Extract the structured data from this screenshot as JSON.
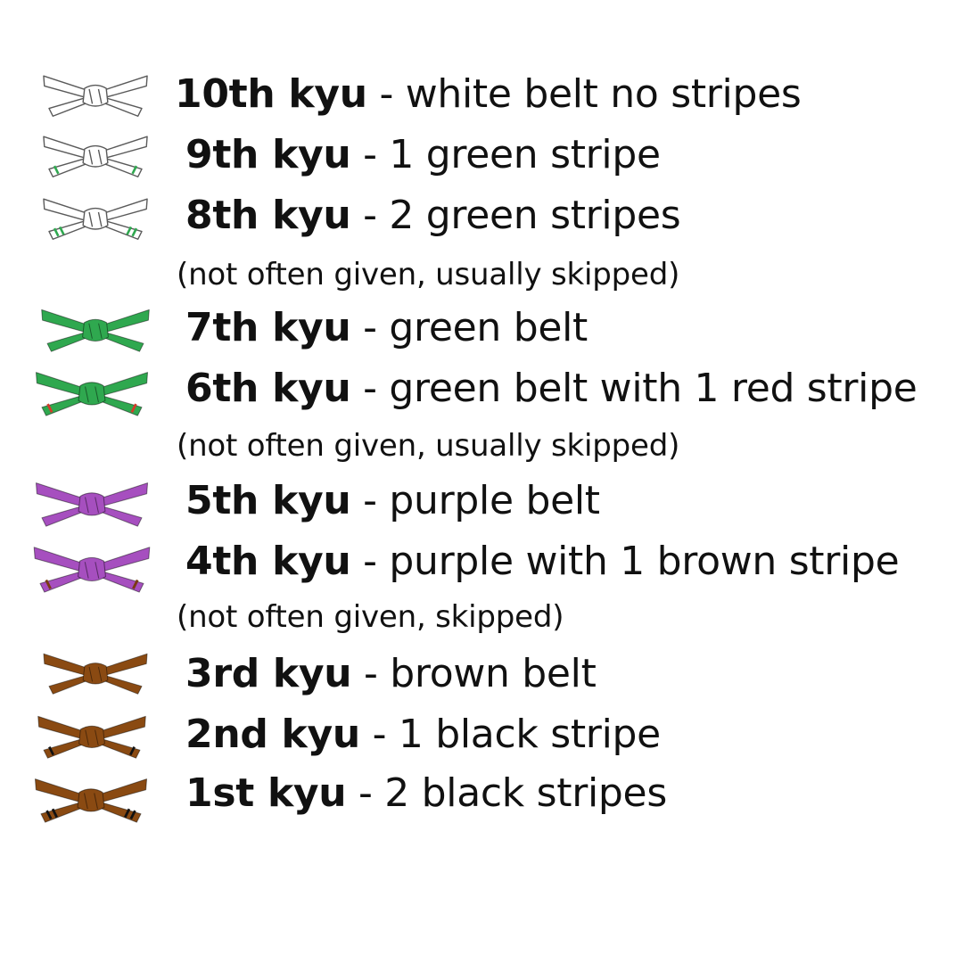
{
  "colors": {
    "white_belt": "#ffffff",
    "green_belt": "#2fa84f",
    "purple_belt": "#a64fbf",
    "brown_belt": "#8a4a12",
    "outline": "#5a5a5a",
    "green_stripe": "#2fa84f",
    "red_stripe": "#d23b2a",
    "brown_stripe": "#7a3b12",
    "black_stripe": "#111111"
  },
  "ranks": [
    {
      "rank": "10th kyu",
      "sep": " - ",
      "desc": "white belt no stripes",
      "belt_color": "#ffffff",
      "stripes": 0,
      "stripe_color": "",
      "icon": "white-belt-icon"
    },
    {
      "rank": "9th kyu",
      "sep": " - ",
      "desc": "1 green stripe",
      "belt_color": "#ffffff",
      "stripes": 1,
      "stripe_color": "#2fa84f",
      "icon": "white-belt-1-green-stripe-icon"
    },
    {
      "rank": "8th kyu",
      "sep": " - ",
      "desc": "2 green stripes",
      "belt_color": "#ffffff",
      "stripes": 2,
      "stripe_color": "#2fa84f",
      "icon": "white-belt-2-green-stripes-icon"
    },
    {
      "rank": "7th kyu",
      "sep": " - ",
      "desc": "green belt",
      "belt_color": "#2fa84f",
      "stripes": 0,
      "stripe_color": "",
      "icon": "green-belt-icon"
    },
    {
      "rank": "6th kyu",
      "sep": " - ",
      "desc": "green belt with 1 red stripe",
      "belt_color": "#2fa84f",
      "stripes": 1,
      "stripe_color": "#d23b2a",
      "icon": "green-belt-red-stripe-icon"
    },
    {
      "rank": "5th kyu",
      "sep": " - ",
      "desc": "purple belt",
      "belt_color": "#a64fbf",
      "stripes": 0,
      "stripe_color": "",
      "icon": "purple-belt-icon"
    },
    {
      "rank": "4th kyu",
      "sep": " - ",
      "desc": "purple with 1 brown stripe",
      "belt_color": "#a64fbf",
      "stripes": 1,
      "stripe_color": "#7a3b12",
      "icon": "purple-belt-brown-stripe-icon"
    },
    {
      "rank": "3rd kyu",
      "sep": " - ",
      "desc": "brown belt",
      "belt_color": "#8a4a12",
      "stripes": 0,
      "stripe_color": "",
      "icon": "brown-belt-icon"
    },
    {
      "rank": "2nd kyu",
      "sep": " - ",
      "desc": "1 black stripe",
      "belt_color": "#8a4a12",
      "stripes": 1,
      "stripe_color": "#111111",
      "icon": "brown-belt-1-black-stripe-icon"
    },
    {
      "rank": "1st kyu",
      "sep": " - ",
      "desc": "2 black stripes",
      "belt_color": "#8a4a12",
      "stripes": 2,
      "stripe_color": "#111111",
      "icon": "brown-belt-2-black-stripes-icon"
    }
  ],
  "notes": [
    "(not often given, usually skipped)",
    "(not often given, usually skipped)",
    "(not often given, skipped)"
  ]
}
